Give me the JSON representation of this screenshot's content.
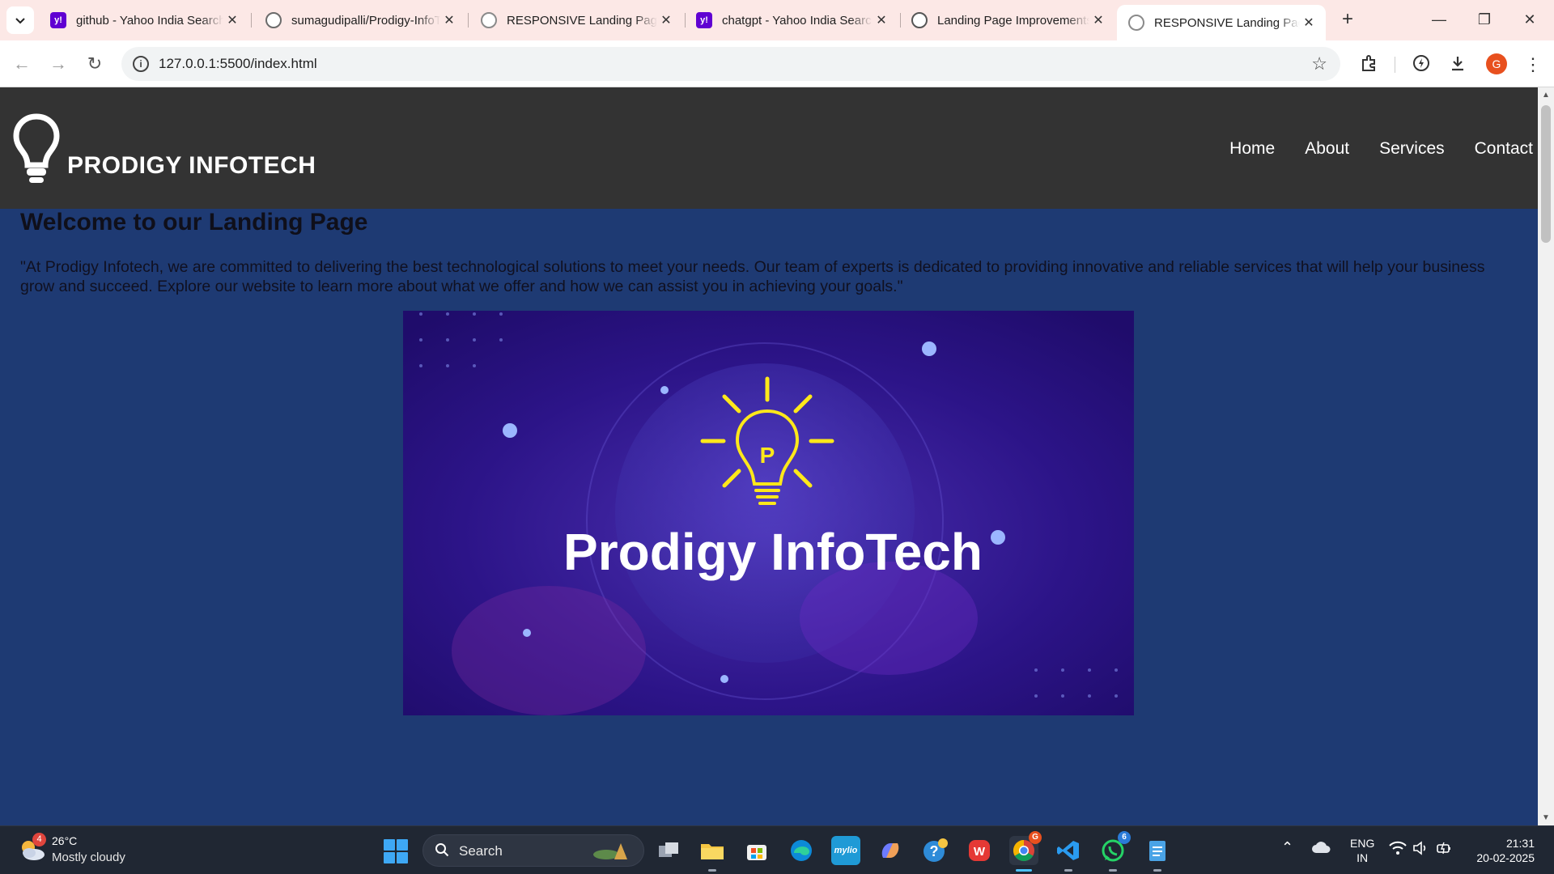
{
  "browser": {
    "tabs": [
      {
        "title": "github - Yahoo India Search",
        "favicon": "yahoo-icon",
        "active": false
      },
      {
        "title": "sumagudipalli/Prodigy-InfoTech",
        "favicon": "github-icon",
        "active": false
      },
      {
        "title": "RESPONSIVE Landing Page",
        "favicon": "globe-icon",
        "active": false
      },
      {
        "title": "chatgpt - Yahoo India Search",
        "favicon": "yahoo-icon",
        "active": false
      },
      {
        "title": "Landing Page Improvements",
        "favicon": "chatgpt-icon",
        "active": false
      },
      {
        "title": "RESPONSIVE Landing Page",
        "favicon": "globe-icon",
        "active": true
      }
    ],
    "url": "127.0.0.1:5500/index.html",
    "profile_initial": "G"
  },
  "site": {
    "brand": "PRODIGY INFOTECH",
    "nav": [
      "Home",
      "About",
      "Services",
      "Contact"
    ],
    "heading": "Welcome to our Landing Page",
    "paragraph": "\"At Prodigy Infotech, we are committed to delivering the best technological solutions to meet your needs. Our team of experts is dedicated to providing innovative and reliable services that will help your business grow and succeed. Explore our website to learn more about what we offer and how we can assist you in achieving your goals.\"",
    "hero_image_text": "Prodigy InfoTech",
    "hero_image_letter": "P",
    "colors": {
      "header": "#333333",
      "background": "#1e3a73",
      "bulb": "#ffe81a"
    }
  },
  "taskbar": {
    "weather": {
      "temp": "26°C",
      "condition": "Mostly cloudy",
      "badge": "4"
    },
    "search_label": "Search",
    "apps": [
      {
        "name": "task-view-icon",
        "badge": ""
      },
      {
        "name": "file-explorer-icon",
        "badge": ""
      },
      {
        "name": "microsoft-store-icon",
        "badge": ""
      },
      {
        "name": "edge-icon",
        "badge": ""
      },
      {
        "name": "mylio-icon",
        "badge": ""
      },
      {
        "name": "copilot-icon",
        "badge": ""
      },
      {
        "name": "help-icon",
        "badge": ""
      },
      {
        "name": "wps-office-icon",
        "badge": ""
      },
      {
        "name": "chrome-icon",
        "badge": "G"
      },
      {
        "name": "vscode-icon",
        "badge": ""
      },
      {
        "name": "whatsapp-icon",
        "badge": "6"
      },
      {
        "name": "notepad-icon",
        "badge": ""
      }
    ],
    "lang": {
      "line1": "ENG",
      "line2": "IN"
    },
    "time": "21:31",
    "date": "20-02-2025"
  }
}
